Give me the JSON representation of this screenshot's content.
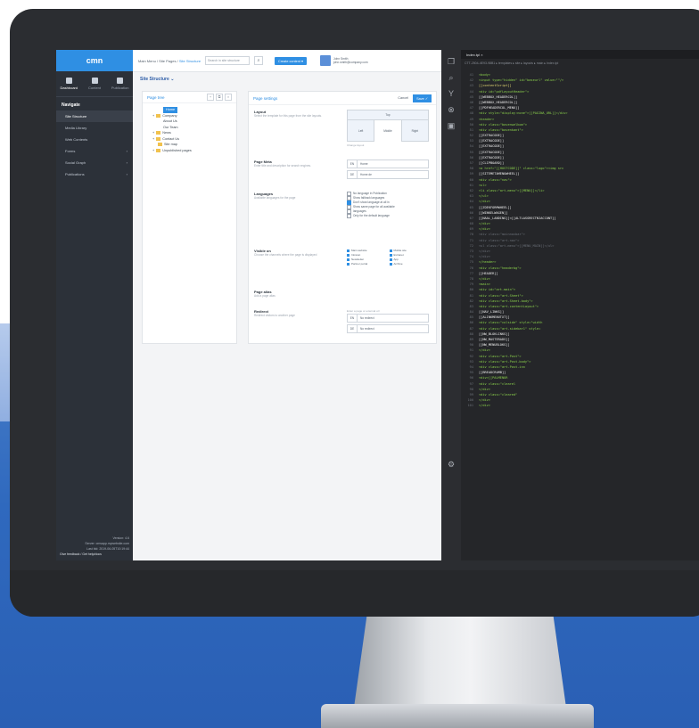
{
  "app": {
    "logo": "cmn",
    "sidebar": {
      "tabs": [
        {
          "label": "Dashboard"
        },
        {
          "label": "Content"
        },
        {
          "label": "Publication"
        }
      ],
      "heading": "Navigate",
      "items": [
        {
          "label": "Site Structure",
          "active": true
        },
        {
          "label": "Media Library",
          "active": false
        },
        {
          "label": "Web Contents",
          "active": false
        },
        {
          "label": "Forms",
          "active": false
        },
        {
          "label": "Social Graph",
          "active": false
        },
        {
          "label": "Publications",
          "active": false
        }
      ],
      "footer": {
        "version": "Version: 4.6",
        "lines": [
          "Server: cmsapp.mywebsite.com",
          "Last bld: 2019-06-05T10:19:44"
        ],
        "link": "Give feedback / Get help/docs"
      }
    },
    "topbar": {
      "breadcrumb_prefix": "Main Menu / Site Pages / ",
      "breadcrumb_current": "Site Structure",
      "search_placeholder": "Search in site structure",
      "search_icon": "search-icon",
      "new_button": "Create content ▾",
      "user_name": "John Smith",
      "user_sub": "john.smith@company.com"
    },
    "page_title": "Site Structure",
    "tree": {
      "title": "Page tree",
      "items": [
        {
          "label": "Home",
          "level": 0,
          "selected": true
        },
        {
          "label": "Company",
          "level": 1
        },
        {
          "label": "About Us",
          "level": 2
        },
        {
          "label": "Our Team",
          "level": 2
        },
        {
          "label": "News",
          "level": 1
        },
        {
          "label": "Contact Us",
          "level": 1
        },
        {
          "label": "Site map",
          "level": 1
        },
        {
          "label": "Unpublished pages",
          "level": 1
        }
      ]
    },
    "form": {
      "title": "Page settings",
      "cancel": "Cancel",
      "save": "Save ✓",
      "layout": {
        "label": "Layout",
        "desc": "Select the template for this page from the site layouts.",
        "top": "Top",
        "cols": [
          "Left",
          "Middle",
          "Right"
        ],
        "link": "Change layout"
      },
      "seo": {
        "label": "Page Meta",
        "desc": "Enter title and description for search engines.",
        "inputs": [
          {
            "prefix": "EN",
            "value": "Home"
          },
          {
            "prefix": "DE",
            "value": "Home de"
          }
        ]
      },
      "languages": {
        "label": "Languages",
        "desc": "Available languages for the page",
        "options": [
          {
            "label": "No language in Publication",
            "on": false
          },
          {
            "label": "Show fallback languages",
            "on": false
          },
          {
            "label": "Don't show language at all in",
            "on": true
          },
          {
            "label": "Show same page for all available",
            "on": false
          },
          {
            "label": "languages",
            "on": false
          },
          {
            "label": "Only for the default language",
            "on": false
          }
        ]
      },
      "visible": {
        "label": "Visible on",
        "desc": "Choose the channels where the page is displayed",
        "options": [
          "Main website",
          "Mobile site",
          "Intranet",
          "Extranet",
          "Newsletter",
          "App",
          "Partner portal",
          "Archive"
        ]
      },
      "alias": {
        "label": "Page alias",
        "placeholder": "Add a page alias"
      },
      "redirect": {
        "label": "Redirect",
        "desc": "Redirect visitors to another page",
        "hint": "Enter a page or external url",
        "inputs": [
          {
            "prefix": "EN",
            "value": "No redirect"
          },
          {
            "prefix": "DE",
            "value": "No redirect"
          }
        ]
      }
    }
  },
  "editor": {
    "tab": "Index.tpl ×",
    "path": "CTT-2504-4E93-98B1 ▸ templates ▸ site ▸ layouts ▸ main ▸ Index.tpl",
    "gutter_icons": [
      "files-icon",
      "search-icon",
      "branch-icon",
      "debug-icon",
      "extensions-icon",
      "settings-icon"
    ],
    "lines": [
      {
        "n": "41",
        "t": "<body>",
        "c": "cg"
      },
      {
        "n": "42",
        "t": "<input type=\"hidden\" id=\"baseurl\" value=\"\"/>",
        "c": "cg"
      },
      {
        "n": "43",
        "t": "  [[contentScript]]",
        "c": "cy"
      },
      {
        "n": "44",
        "t": "  <div id=\"pdfLayoutHeader\">",
        "c": "cg"
      },
      {
        "n": "45",
        "t": "  [[WEBBOX_HEADERCOL]]",
        "c": "cw"
      },
      {
        "n": "46",
        "t": "  [[WEBBOX_HEADERCOL]]",
        "c": "cw"
      },
      {
        "n": "47",
        "t": "  [[PDFHEADERCOL_MENU]]",
        "c": "cw"
      },
      {
        "n": "48",
        "t": "  <div style=\"display:none\">[[PAGINA_URL]]</div>",
        "c": "cg"
      },
      {
        "n": "49",
        "t": "  <header>",
        "c": "cg"
      },
      {
        "n": "50",
        "t": "    <div class=\"bovenwelkom\">",
        "c": "cg"
      },
      {
        "n": "51",
        "t": "      <div class=\"bovenkant\">",
        "c": "cg"
      },
      {
        "n": "52",
        "t": "        [[EXTRACODE]]",
        "c": "cw"
      },
      {
        "n": "53",
        "t": "        [[EXTRACODE]]",
        "c": "cw"
      },
      {
        "n": "54",
        "t": "        [[EXTRACODE]]",
        "c": "cw"
      },
      {
        "n": "55",
        "t": "        [[EXTRACODE]]",
        "c": "cw"
      },
      {
        "n": "56",
        "t": "        [[EXTRACODE]]",
        "c": "cw"
      },
      {
        "n": "57",
        "t": "        [[CLIPBOARD]]",
        "c": "cw"
      },
      {
        "n": "58",
        "t": "        <a href=\"[[HOSTCODE]]\" class=\"logo\"><img src",
        "c": "cg"
      },
      {
        "n": "59",
        "t": "        [[SITEMETAMENUWHEEL]]",
        "c": "cw"
      },
      {
        "n": "60",
        "t": "        <div class=\"nav\">",
        "c": "cg"
      },
      {
        "n": "61",
        "t": "          <ul>",
        "c": "cg"
      },
      {
        "n": "62",
        "t": "            <li class=\"art-menu\">[[MENU]]</li>",
        "c": "cg"
      },
      {
        "n": "63",
        "t": "          </ul>",
        "c": "cg"
      },
      {
        "n": "64",
        "t": "        </div>",
        "c": "cg"
      },
      {
        "n": "65",
        "t": "        [[ZOEKFORMWHEEL]]",
        "c": "cw"
      },
      {
        "n": "66",
        "t": "        [[WINKELWAGEN]]",
        "c": "cw"
      },
      {
        "n": "67",
        "t": "        [[NAAL_LANDING]]<[[ALTLASGRECTNIACCONT]]",
        "c": "cw"
      },
      {
        "n": "68",
        "t": "      </div>",
        "c": "cg"
      },
      {
        "n": "69",
        "t": "    </div>",
        "c": "cg"
      },
      {
        "n": "70",
        "t": "    <div class=\"mainnavbar\">",
        "c": "cm"
      },
      {
        "n": "71",
        "t": "      <div class=\"art-nav\">",
        "c": "cm"
      },
      {
        "n": "72",
        "t": "        <ul class=\"art-menu\">[[MENU_MAIN]]</ul>",
        "c": "cm"
      },
      {
        "n": "73",
        "t": "      </div>",
        "c": "cm"
      },
      {
        "n": "74",
        "t": "    </div>",
        "c": "cm"
      },
      {
        "n": "75",
        "t": "  </header>",
        "c": "cg"
      },
      {
        "n": "76",
        "t": "  <div class=\"headerbg\">",
        "c": "cg"
      },
      {
        "n": "77",
        "t": "  [[HEADER]]",
        "c": "cw"
      },
      {
        "n": "78",
        "t": "  </div>",
        "c": "cg"
      },
      {
        "n": "79",
        "t": "  <main>",
        "c": "cg"
      },
      {
        "n": "80",
        "t": "    <div id=\"art-main\">",
        "c": "cg"
      },
      {
        "n": "81",
        "t": "      <div class=\"art-Sheet\">",
        "c": "cg"
      },
      {
        "n": "82",
        "t": "        <div class=\"art-Sheet-body\">",
        "c": "cg"
      },
      {
        "n": "83",
        "t": "          <div class=\"art-contentLayout\">",
        "c": "cg"
      },
      {
        "n": "84",
        "t": "            [[NAV_LINKS]]",
        "c": "cw"
      },
      {
        "n": "85",
        "t": "            [[ALINKMENUTXT]]",
        "c": "cw"
      },
      {
        "n": "86",
        "t": "            <div class=\"colside\" style=\"width",
        "c": "cg"
      },
      {
        "n": "87",
        "t": "              <div class=\"art-sidebar1\" style=",
        "c": "cg"
      },
      {
        "n": "88",
        "t": "                [[NW_BLOKLINKS]]",
        "c": "cw"
      },
      {
        "n": "89",
        "t": "                [[NW_MASTERADS]]",
        "c": "cw"
      },
      {
        "n": "90",
        "t": "                [[NW_MENUBLOKS]]",
        "c": "cw"
      },
      {
        "n": "91",
        "t": "              </div>",
        "c": "cg"
      },
      {
        "n": "92",
        "t": "              <div class=\"art-Post\">",
        "c": "cg"
      },
      {
        "n": "93",
        "t": "                <div class=\"art-Post-body\">",
        "c": "cg"
      },
      {
        "n": "94",
        "t": "                  <div class=\"art-Post-inn",
        "c": "cg"
      },
      {
        "n": "95",
        "t": "                    [[BREADCRUMB]]",
        "c": "cw"
      },
      {
        "n": "96",
        "t": "                    <div>[[PALMENUR",
        "c": "cg"
      },
      {
        "n": "97",
        "t": "                    <div class=\"clearel",
        "c": "cg"
      },
      {
        "n": "98",
        "t": "                  </div>",
        "c": "cg"
      },
      {
        "n": "99",
        "t": "                  <div class=\"cleared\"",
        "c": "cg"
      },
      {
        "n": "100",
        "t": "                </div>",
        "c": "cg"
      },
      {
        "n": "101",
        "t": "              </div>",
        "c": "cg"
      }
    ]
  }
}
